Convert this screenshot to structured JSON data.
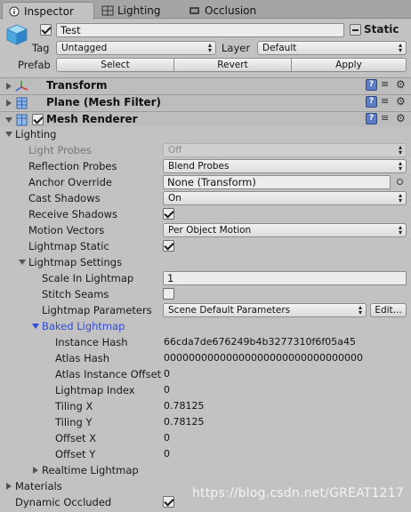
{
  "tabs": [
    {
      "label": "Inspector",
      "icon": "info-icon"
    },
    {
      "label": "Lighting",
      "icon": "lighting-icon"
    },
    {
      "label": "Occlusion",
      "icon": "occlusion-icon"
    }
  ],
  "header": {
    "name": "Test",
    "static_label": "Static",
    "tag_label": "Tag",
    "tag_value": "Untagged",
    "layer_label": "Layer",
    "layer_value": "Default",
    "prefab_label": "Prefab",
    "select_label": "Select",
    "revert_label": "Revert",
    "apply_label": "Apply"
  },
  "components": {
    "transform": "Transform",
    "mesh_filter": "Plane (Mesh Filter)",
    "mesh_renderer": "Mesh Renderer"
  },
  "lighting": {
    "section_label": "Lighting",
    "light_probes_label": "Light Probes",
    "light_probes_value": "Off",
    "reflection_probes_label": "Reflection Probes",
    "reflection_probes_value": "Blend Probes",
    "anchor_override_label": "Anchor Override",
    "anchor_override_value": "None (Transform)",
    "cast_shadows_label": "Cast Shadows",
    "cast_shadows_value": "On",
    "receive_shadows_label": "Receive Shadows",
    "motion_vectors_label": "Motion Vectors",
    "motion_vectors_value": "Per Object Motion",
    "lightmap_static_label": "Lightmap Static",
    "lightmap_settings_label": "Lightmap Settings",
    "scale_label": "Scale In Lightmap",
    "scale_value": "1",
    "stitch_label": "Stitch Seams",
    "params_label": "Lightmap Parameters",
    "params_value": "Scene Default Parameters",
    "edit_label": "Edit...",
    "baked_label": "Baked Lightmap",
    "realtime_label": "Realtime Lightmap"
  },
  "baked": [
    {
      "label": "Instance Hash",
      "value": "66cda7de676249b4b3277310f6f05a45"
    },
    {
      "label": "Atlas Hash",
      "value": "00000000000000000000000000000000"
    },
    {
      "label": "Atlas Instance Offset",
      "value": "0"
    },
    {
      "label": "Lightmap Index",
      "value": "0"
    },
    {
      "label": "Tiling X",
      "value": "0.78125"
    },
    {
      "label": "Tiling Y",
      "value": "0.78125"
    },
    {
      "label": "Offset X",
      "value": "0"
    },
    {
      "label": "Offset Y",
      "value": "0"
    }
  ],
  "footer": {
    "materials_label": "Materials",
    "dynamic_occluded_label": "Dynamic Occluded",
    "watermark": "https://blog.csdn.net/GREAT1217"
  }
}
